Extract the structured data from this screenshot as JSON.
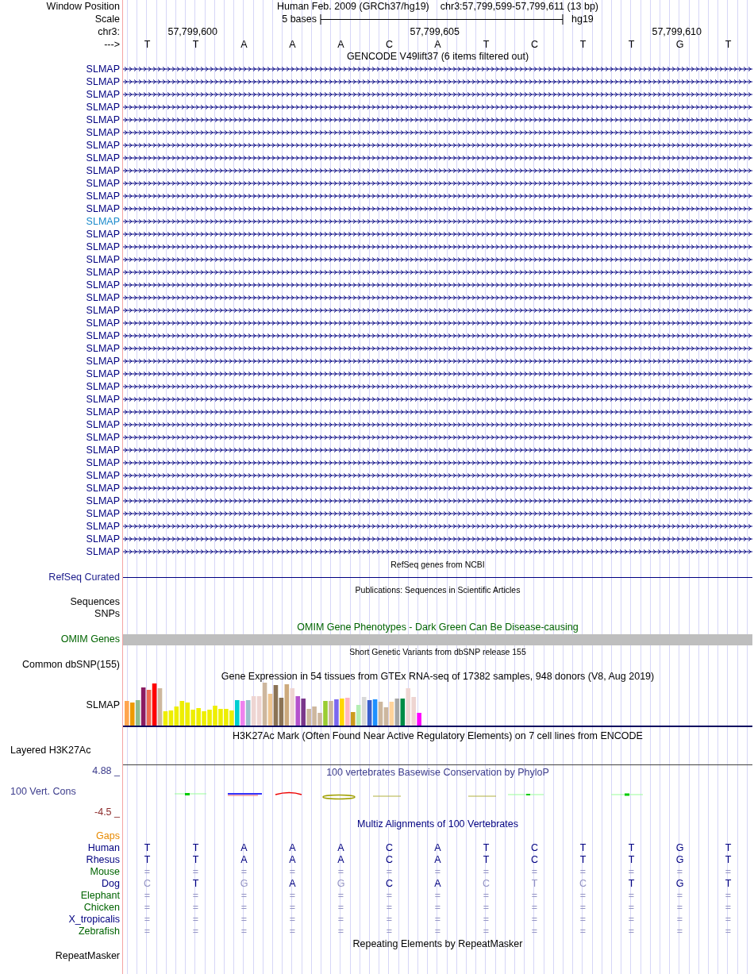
{
  "header": {
    "label": "Window Position",
    "assembly": "Human Feb. 2009 (GRCh37/hg19)",
    "position": "chr3:57,799,599-57,799,611 (13 bp)"
  },
  "scale": {
    "label": "Scale",
    "bar_label": "5 bases",
    "assembly": "hg19"
  },
  "ruler": {
    "label": "chr3:",
    "ticks": [
      "57,799,600",
      "57,799,605",
      "57,799,610"
    ]
  },
  "strand": {
    "label": "--->",
    "bases": [
      "T",
      "T",
      "A",
      "A",
      "A",
      "C",
      "A",
      "T",
      "C",
      "T",
      "T",
      "G",
      "T"
    ]
  },
  "gencode": {
    "title": "GENCODE V49lift37 (6 items filtered out)",
    "genes": [
      {
        "name": "SLMAP",
        "highlighted": false
      },
      {
        "name": "SLMAP",
        "highlighted": false
      },
      {
        "name": "SLMAP",
        "highlighted": false
      },
      {
        "name": "SLMAP",
        "highlighted": false
      },
      {
        "name": "SLMAP",
        "highlighted": false
      },
      {
        "name": "SLMAP",
        "highlighted": false
      },
      {
        "name": "SLMAP",
        "highlighted": false
      },
      {
        "name": "SLMAP",
        "highlighted": false
      },
      {
        "name": "SLMAP",
        "highlighted": false
      },
      {
        "name": "SLMAP",
        "highlighted": false
      },
      {
        "name": "SLMAP",
        "highlighted": false
      },
      {
        "name": "SLMAP",
        "highlighted": false
      },
      {
        "name": "SLMAP",
        "highlighted": true
      },
      {
        "name": "SLMAP",
        "highlighted": false
      },
      {
        "name": "SLMAP",
        "highlighted": false
      },
      {
        "name": "SLMAP",
        "highlighted": false
      },
      {
        "name": "SLMAP",
        "highlighted": false
      },
      {
        "name": "SLMAP",
        "highlighted": false
      },
      {
        "name": "SLMAP",
        "highlighted": false
      },
      {
        "name": "SLMAP",
        "highlighted": false
      },
      {
        "name": "SLMAP",
        "highlighted": false
      },
      {
        "name": "SLMAP",
        "highlighted": false
      },
      {
        "name": "SLMAP",
        "highlighted": false
      },
      {
        "name": "SLMAP",
        "highlighted": false
      },
      {
        "name": "SLMAP",
        "highlighted": false
      },
      {
        "name": "SLMAP",
        "highlighted": false
      },
      {
        "name": "SLMAP",
        "highlighted": false
      },
      {
        "name": "SLMAP",
        "highlighted": false
      },
      {
        "name": "SLMAP",
        "highlighted": false
      },
      {
        "name": "SLMAP",
        "highlighted": false
      },
      {
        "name": "SLMAP",
        "highlighted": false
      },
      {
        "name": "SLMAP",
        "highlighted": false
      },
      {
        "name": "SLMAP",
        "highlighted": false
      },
      {
        "name": "SLMAP",
        "highlighted": false
      },
      {
        "name": "SLMAP",
        "highlighted": false
      },
      {
        "name": "SLMAP",
        "highlighted": false
      },
      {
        "name": "SLMAP",
        "highlighted": false
      },
      {
        "name": "SLMAP",
        "highlighted": false
      },
      {
        "name": "SLMAP",
        "highlighted": false
      }
    ]
  },
  "refseq": {
    "title": "RefSeq genes from NCBI",
    "label": "RefSeq Curated"
  },
  "publications": {
    "title": "Publications: Sequences in Scientific Articles",
    "labels": [
      "Sequences",
      "SNPs"
    ]
  },
  "omim": {
    "title": "OMIM Gene Phenotypes - Dark Green Can Be Disease-causing",
    "label": "OMIM Genes"
  },
  "dbsnp": {
    "title": "Short Genetic Variants from dbSNP release 155",
    "label": "Common dbSNP(155)"
  },
  "gtex": {
    "title": "Gene Expression in 54 tissues from GTEx RNA-seq of 17382 samples, 948 donors (V8, Aug 2019)",
    "label": "SLMAP"
  },
  "h3k27ac": {
    "title": "H3K27Ac Mark (Often Found Near Active Regulatory Elements) on 7 cell lines from ENCODE",
    "label": "Layered H3K27Ac"
  },
  "phylop": {
    "title": "100 vertebrates Basewise Conservation by PhyloP",
    "max": "4.88 _",
    "label": "100 Vert. Cons",
    "min": "-4.5 _"
  },
  "multiz": {
    "title": "Multiz Alignments of 100 Vertebrates",
    "gaps_label": "Gaps",
    "species": [
      {
        "name": "Human",
        "color": "#000080",
        "bases": [
          {
            "b": "T",
            "dim": false
          },
          {
            "b": "T",
            "dim": false
          },
          {
            "b": "A",
            "dim": false
          },
          {
            "b": "A",
            "dim": false
          },
          {
            "b": "A",
            "dim": false
          },
          {
            "b": "C",
            "dim": false
          },
          {
            "b": "A",
            "dim": false
          },
          {
            "b": "T",
            "dim": false
          },
          {
            "b": "C",
            "dim": false
          },
          {
            "b": "T",
            "dim": false
          },
          {
            "b": "T",
            "dim": false
          },
          {
            "b": "G",
            "dim": false
          },
          {
            "b": "T",
            "dim": false
          }
        ]
      },
      {
        "name": "Rhesus",
        "color": "#000080",
        "bases": [
          {
            "b": "T",
            "dim": false
          },
          {
            "b": "T",
            "dim": false
          },
          {
            "b": "A",
            "dim": false
          },
          {
            "b": "A",
            "dim": false
          },
          {
            "b": "A",
            "dim": false
          },
          {
            "b": "C",
            "dim": false
          },
          {
            "b": "A",
            "dim": false
          },
          {
            "b": "T",
            "dim": false
          },
          {
            "b": "C",
            "dim": false
          },
          {
            "b": "T",
            "dim": false
          },
          {
            "b": "T",
            "dim": false
          },
          {
            "b": "G",
            "dim": false
          },
          {
            "b": "T",
            "dim": false
          }
        ]
      },
      {
        "name": "Mouse",
        "color": "#006400",
        "bases": [
          {
            "b": "=",
            "dim": true
          },
          {
            "b": "=",
            "dim": true
          },
          {
            "b": "=",
            "dim": true
          },
          {
            "b": "=",
            "dim": true
          },
          {
            "b": "=",
            "dim": true
          },
          {
            "b": "=",
            "dim": true
          },
          {
            "b": "=",
            "dim": true
          },
          {
            "b": "=",
            "dim": true
          },
          {
            "b": "=",
            "dim": true
          },
          {
            "b": "=",
            "dim": true
          },
          {
            "b": "=",
            "dim": true
          },
          {
            "b": "=",
            "dim": true
          },
          {
            "b": "=",
            "dim": true
          }
        ]
      },
      {
        "name": "Dog",
        "color": "#000080",
        "bases": [
          {
            "b": "C",
            "dim": true
          },
          {
            "b": "T",
            "dim": false
          },
          {
            "b": "G",
            "dim": true
          },
          {
            "b": "A",
            "dim": false
          },
          {
            "b": "G",
            "dim": true
          },
          {
            "b": "C",
            "dim": false
          },
          {
            "b": "A",
            "dim": false
          },
          {
            "b": "C",
            "dim": true
          },
          {
            "b": "T",
            "dim": true
          },
          {
            "b": "C",
            "dim": true
          },
          {
            "b": "T",
            "dim": false
          },
          {
            "b": "G",
            "dim": false
          },
          {
            "b": "T",
            "dim": false
          }
        ]
      },
      {
        "name": "Elephant",
        "color": "#006400",
        "bases": [
          {
            "b": "=",
            "dim": true
          },
          {
            "b": "=",
            "dim": true
          },
          {
            "b": "=",
            "dim": true
          },
          {
            "b": "=",
            "dim": true
          },
          {
            "b": "=",
            "dim": true
          },
          {
            "b": "=",
            "dim": true
          },
          {
            "b": "=",
            "dim": true
          },
          {
            "b": "=",
            "dim": true
          },
          {
            "b": "=",
            "dim": true
          },
          {
            "b": "=",
            "dim": true
          },
          {
            "b": "=",
            "dim": true
          },
          {
            "b": "=",
            "dim": true
          },
          {
            "b": "=",
            "dim": true
          }
        ]
      },
      {
        "name": "Chicken",
        "color": "#006400",
        "bases": [
          {
            "b": "=",
            "dim": true
          },
          {
            "b": "=",
            "dim": true
          },
          {
            "b": "=",
            "dim": true
          },
          {
            "b": "=",
            "dim": true
          },
          {
            "b": "=",
            "dim": true
          },
          {
            "b": "=",
            "dim": true
          },
          {
            "b": "=",
            "dim": true
          },
          {
            "b": "=",
            "dim": true
          },
          {
            "b": "=",
            "dim": true
          },
          {
            "b": "=",
            "dim": true
          },
          {
            "b": "=",
            "dim": true
          },
          {
            "b": "=",
            "dim": true
          },
          {
            "b": "=",
            "dim": true
          }
        ]
      },
      {
        "name": "X_tropicalis",
        "color": "#000080",
        "bases": [
          {
            "b": "=",
            "dim": true
          },
          {
            "b": "=",
            "dim": true
          },
          {
            "b": "=",
            "dim": true
          },
          {
            "b": "=",
            "dim": true
          },
          {
            "b": "=",
            "dim": true
          },
          {
            "b": "=",
            "dim": true
          },
          {
            "b": "=",
            "dim": true
          },
          {
            "b": "=",
            "dim": true
          },
          {
            "b": "=",
            "dim": true
          },
          {
            "b": "=",
            "dim": true
          },
          {
            "b": "=",
            "dim": true
          },
          {
            "b": "=",
            "dim": true
          },
          {
            "b": "=",
            "dim": true
          }
        ]
      },
      {
        "name": "Zebrafish",
        "color": "#006400",
        "bases": [
          {
            "b": "=",
            "dim": true
          },
          {
            "b": "=",
            "dim": true
          },
          {
            "b": "=",
            "dim": true
          },
          {
            "b": "=",
            "dim": true
          },
          {
            "b": "=",
            "dim": true
          },
          {
            "b": "=",
            "dim": true
          },
          {
            "b": "=",
            "dim": true
          },
          {
            "b": "=",
            "dim": true
          },
          {
            "b": "=",
            "dim": true
          },
          {
            "b": "=",
            "dim": true
          },
          {
            "b": "=",
            "dim": true
          },
          {
            "b": "=",
            "dim": true
          },
          {
            "b": "=",
            "dim": true
          }
        ]
      }
    ]
  },
  "repeatmasker": {
    "title": "Repeating Elements by RepeatMasker",
    "label": "RepeatMasker"
  }
}
